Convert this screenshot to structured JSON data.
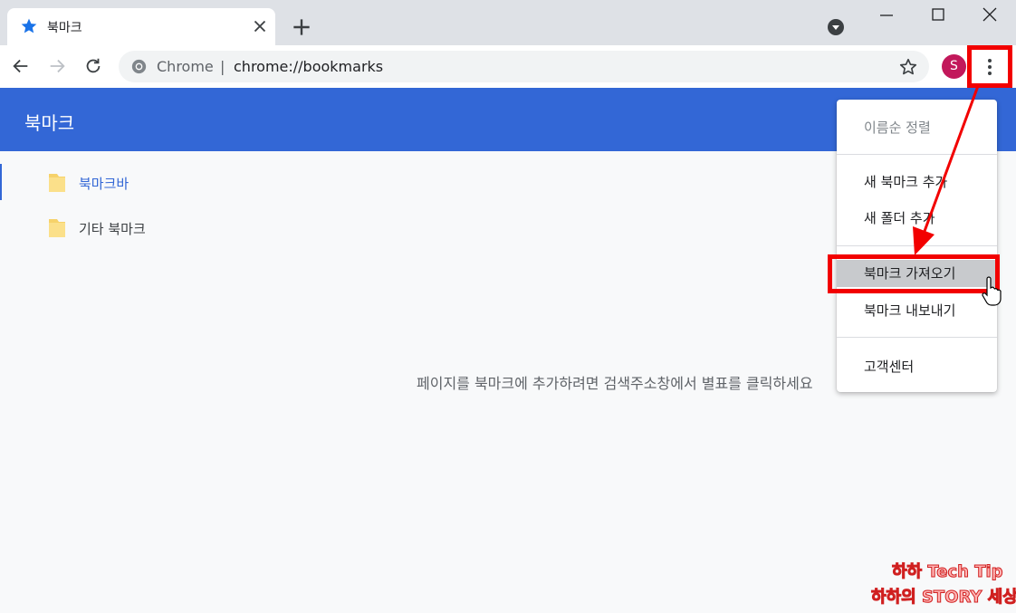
{
  "tab": {
    "title": "북마크"
  },
  "toolbar": {
    "omnibox_scheme_label": "Chrome",
    "omnibox_sep": "|",
    "omnibox_url": "chrome://bookmarks",
    "avatar_letter": "S"
  },
  "app": {
    "title": "북마크"
  },
  "sidebar": {
    "items": [
      {
        "label": "북마크바",
        "selected": true
      },
      {
        "label": "기타 북마크",
        "selected": false
      }
    ]
  },
  "main": {
    "empty_message": "페이지를 북마크에 추가하려면 검색주소창에서 별표를 클릭하세요"
  },
  "menu": {
    "items": [
      {
        "label": "이름순 정렬",
        "disabled": true
      },
      {
        "label": "새 북마크 추가"
      },
      {
        "label": "새 폴더 추가"
      },
      {
        "label": "북마크 가져오기",
        "hovered": true
      },
      {
        "label": "북마크 내보내기"
      },
      {
        "label": "고객센터"
      }
    ]
  },
  "watermark": {
    "line1": "하하 Tech Tip",
    "line2": "하하의 STORY 세상"
  },
  "colors": {
    "accent": "#3367d6",
    "annotation_red": "#f20000",
    "folder": "#f6d26a",
    "avatar": "#c2185b"
  }
}
